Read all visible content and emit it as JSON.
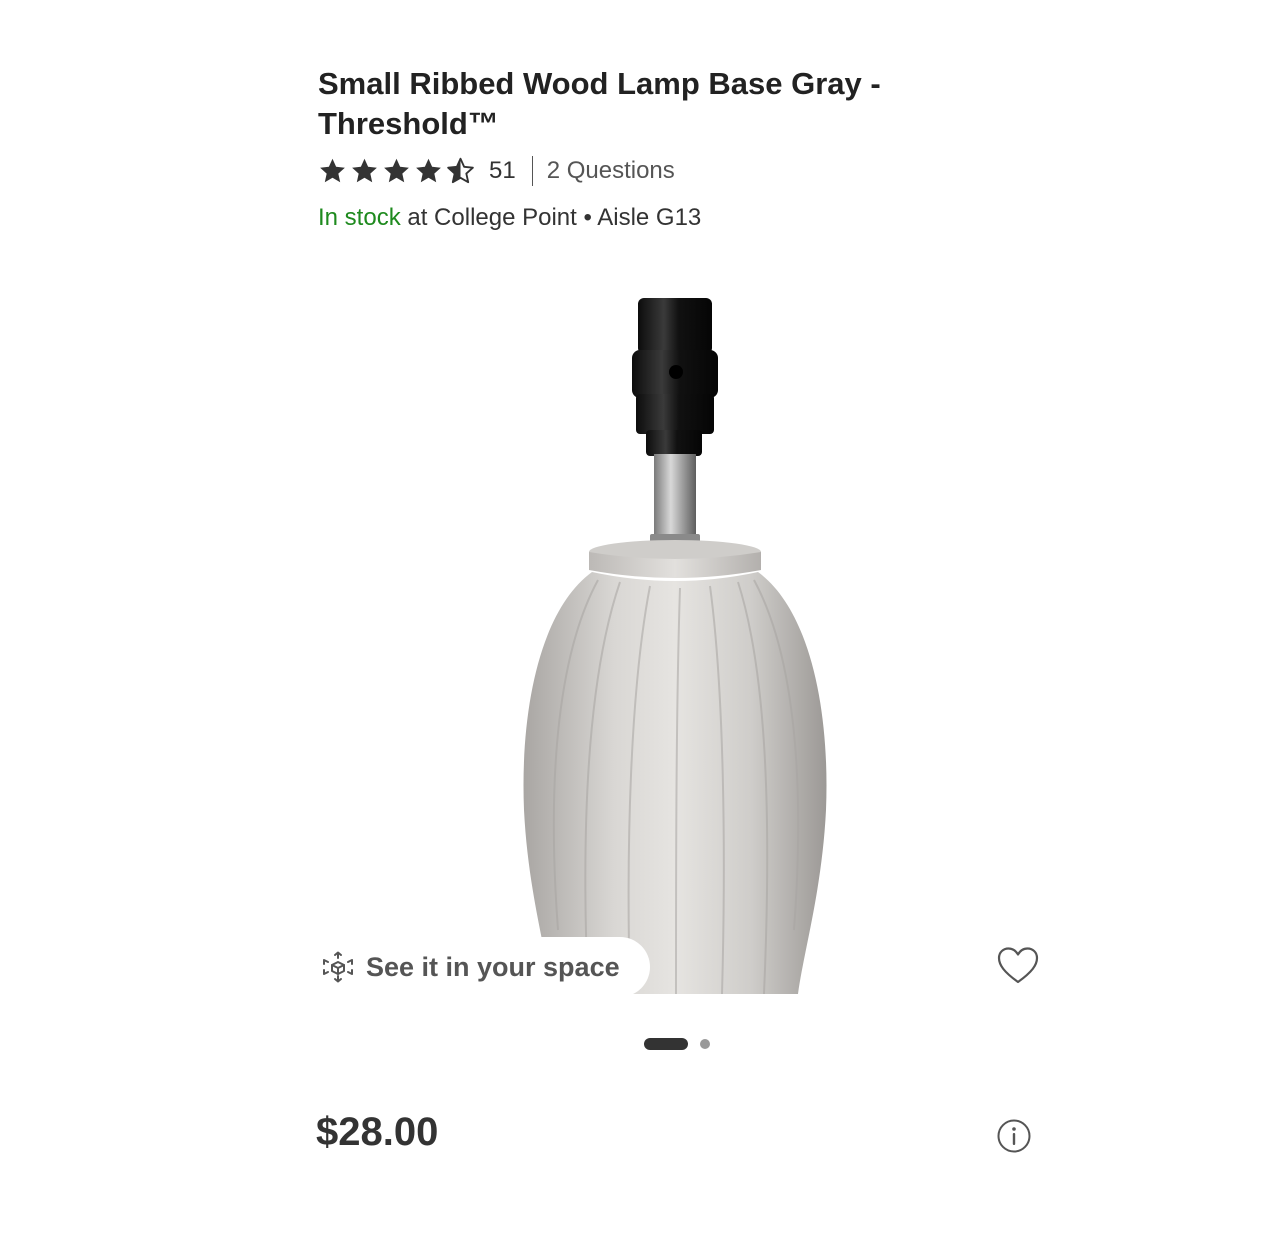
{
  "product": {
    "title": "Small Ribbed Wood Lamp Base Gray - Threshold™",
    "rating": 4.5,
    "review_count": "51",
    "questions_label": "2 Questions",
    "stock_status": "In stock",
    "stock_location": " at College Point • Aisle G13",
    "price": "$28.00",
    "see_in_space_label": "See it in your space",
    "image_icon": "lamp-base-product-photo",
    "carousel": {
      "total": 2,
      "active_index": 1
    }
  },
  "icons": {
    "ar": "ar-cube-icon",
    "favorite": "heart-icon",
    "info": "info-icon",
    "star": "star-icon"
  },
  "colors": {
    "in_stock": "#1e8a1e",
    "text": "#333333"
  }
}
